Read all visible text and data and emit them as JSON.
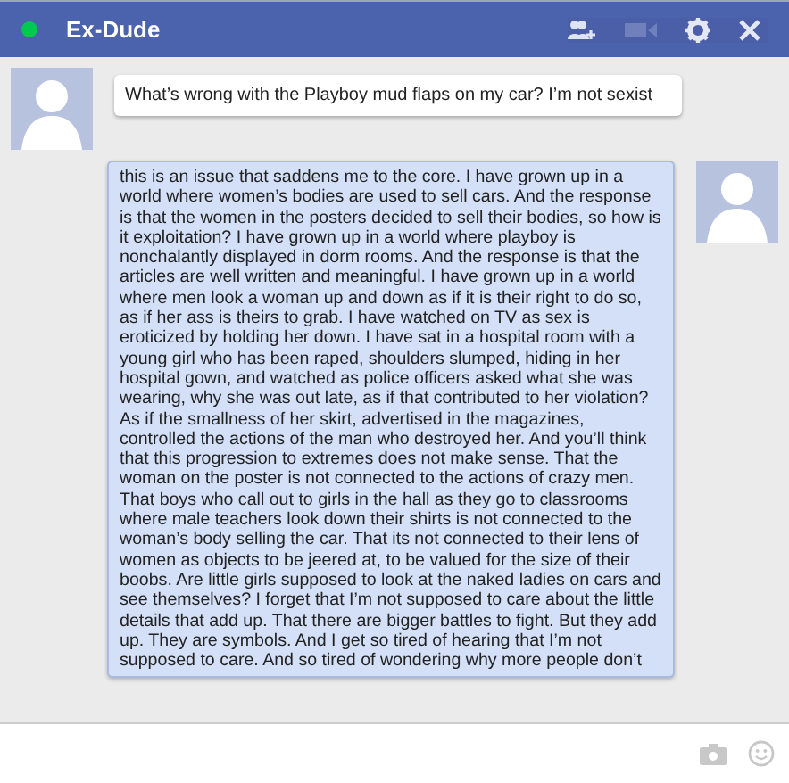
{
  "header": {
    "title": "Ex-Dude",
    "online": true
  },
  "messages": [
    {
      "kind": "incoming",
      "text": "What’s wrong with the Playboy mud flaps on my car?  I’m not sexist"
    },
    {
      "kind": "outgoing",
      "text": "this is an issue that saddens me to the core. I have grown up in a world where women’s bodies are used to sell cars.  And the response is that the women in the posters decided to sell their bodies, so how is it exploitation? I have grown up in a world where playboy is nonchalantly displayed in dorm rooms.  And the response is that the articles are well written and meaningful.  I have grown up in a world where men look a woman up and down as if it is their right to do so, as if her ass is theirs to grab. I have watched on TV as sex is eroticized by holding her down.  I have sat in a hospital room with a young girl who has been raped, shoulders slumped, hiding in her hospital gown, and watched as police officers asked what she was wearing, why she was out late, as if that contributed to her violation? As if the smallness of her skirt, advertised in the magazines, controlled the actions of the man who destroyed her.  And you’ll think that this progression to extremes does not make sense.  That the woman on the poster is not connected to the actions of crazy men. That boys who call out to girls in the hall as they go to classrooms where male teachers look down their shirts is not connected to the woman’s body selling the car. That its not connected to their lens of women as objects to be jeered at, to be valued for the size of their boobs. Are little girls supposed to look at the naked ladies on cars and see themselves? I forget that I’m not supposed to care about the little details that add up.  That there are bigger battles to fight.  But they add up. They are symbols. And I get so tired of hearing that I’m not supposed to care.  And so tired of wondering why more people don’t"
    }
  ]
}
